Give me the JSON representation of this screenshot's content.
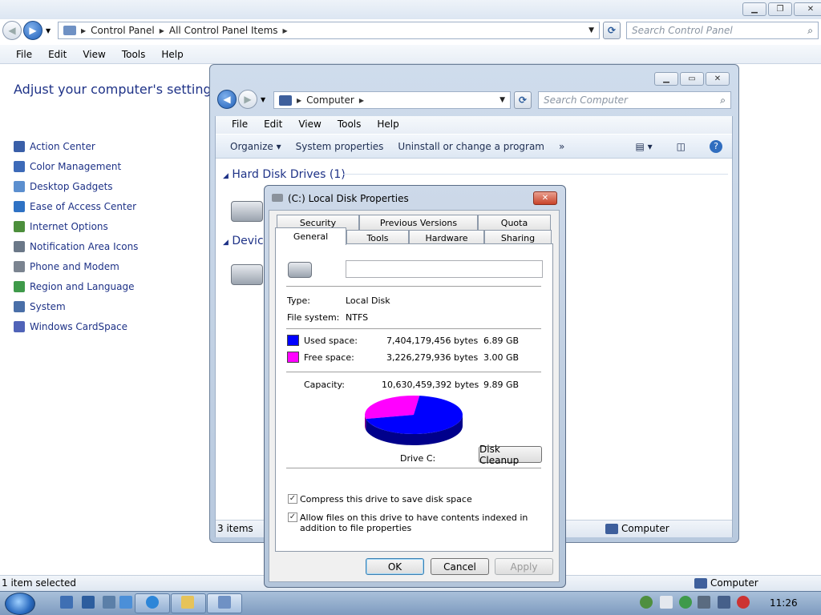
{
  "control_panel": {
    "breadcrumb": [
      "Control Panel",
      "All Control Panel Items"
    ],
    "search_placeholder": "Search Control Panel",
    "menu": [
      "File",
      "Edit",
      "View",
      "Tools",
      "Help"
    ],
    "heading": "Adjust your computer's settings",
    "items": [
      {
        "label": "Action Center",
        "icon": "flag-icon",
        "color": "#3a5fa8"
      },
      {
        "label": "Color Management",
        "icon": "monitor-icon",
        "color": "#3d6ab8"
      },
      {
        "label": "Desktop Gadgets",
        "icon": "gadget-icon",
        "color": "#5c8fcf"
      },
      {
        "label": "Ease of Access Center",
        "icon": "accessibility-icon",
        "color": "#2f72c4"
      },
      {
        "label": "Internet Options",
        "icon": "globe-icon",
        "color": "#4c8f3c"
      },
      {
        "label": "Notification Area Icons",
        "icon": "tray-icon",
        "color": "#6b7888"
      },
      {
        "label": "Phone and Modem",
        "icon": "phone-icon",
        "color": "#7b8490"
      },
      {
        "label": "Region and Language",
        "icon": "globe-clock-icon",
        "color": "#3f9a4a"
      },
      {
        "label": "System",
        "icon": "computer-icon",
        "color": "#4a6fa8"
      },
      {
        "label": "Windows CardSpace",
        "icon": "cardspace-icon",
        "color": "#5063b8"
      }
    ],
    "status_left": "1 item selected",
    "status_right": "Computer"
  },
  "computer_window": {
    "breadcrumb": [
      "Computer"
    ],
    "search_placeholder": "Search Computer",
    "menu": [
      "File",
      "Edit",
      "View",
      "Tools",
      "Help"
    ],
    "commands": [
      "Organize",
      "System properties",
      "Uninstall or change a program",
      "»"
    ],
    "group_hdd": "Hard Disk Drives (1)",
    "group_devices": "Device",
    "status_items": "3 items",
    "status_right": "Computer"
  },
  "dialog": {
    "title": "(C:) Local Disk Properties",
    "tabs_back": [
      "Security",
      "Previous Versions",
      "Quota"
    ],
    "tabs_front": [
      "General",
      "Tools",
      "Hardware",
      "Sharing"
    ],
    "name_value": "",
    "type_label": "Type:",
    "type_value": "Local Disk",
    "fs_label": "File system:",
    "fs_value": "NTFS",
    "used_label": "Used space:",
    "used_bytes": "7,404,179,456 bytes",
    "used_gb": "6.89 GB",
    "free_label": "Free space:",
    "free_bytes": "3,226,279,936 bytes",
    "free_gb": "3.00 GB",
    "capacity_label": "Capacity:",
    "capacity_bytes": "10,630,459,392 bytes",
    "capacity_gb": "9.89 GB",
    "drive_label": "Drive C:",
    "disk_cleanup": "Disk Cleanup",
    "compress_label": "Compress this drive to save disk space",
    "compress_checked": true,
    "index_label": "Allow files on this drive to have contents indexed in addition to file properties",
    "index_checked": true,
    "ok": "OK",
    "cancel": "Cancel",
    "apply": "Apply",
    "used_color": "#0000ff",
    "free_color": "#ff00ff",
    "used_fraction": 0.6965
  },
  "taskbar": {
    "time": "11:26"
  }
}
